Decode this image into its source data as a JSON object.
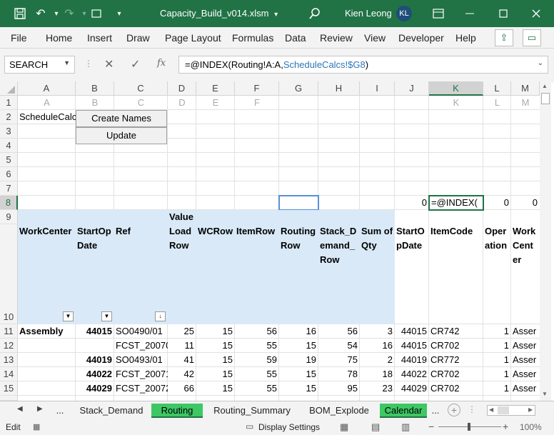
{
  "title_bar": {
    "filename": "Capacity_Build_v014.xlsm",
    "dropdown_glyph": "▾",
    "user_name": "Kien Leong",
    "user_initials": "KL",
    "bg_color": "#217346"
  },
  "menu": {
    "items": [
      "File",
      "Home",
      "Insert",
      "Draw",
      "Page Layout",
      "Formulas",
      "Data",
      "Review",
      "View",
      "Developer",
      "Help"
    ]
  },
  "formula_bar": {
    "name_box": "SEARCH",
    "formula_prefix": "=@INDEX(Routing!A:A,",
    "formula_ref": "ScheduleCalcs!$G8",
    "formula_suffix": ")",
    "fx": "fx"
  },
  "columns": [
    "A",
    "B",
    "C",
    "D",
    "E",
    "F",
    "G",
    "H",
    "I",
    "J",
    "K",
    "L",
    "M"
  ],
  "ghost_row": [
    "A",
    "B",
    "C",
    "D",
    "E",
    "F",
    "",
    "",
    "",
    "",
    "K",
    "L",
    "M"
  ],
  "rows": [
    "1",
    "2",
    "3",
    "4",
    "5",
    "6",
    "7",
    "8",
    "9",
    "10",
    "11",
    "12",
    "13",
    "14",
    "15"
  ],
  "a2_text": "ScheduleCalc",
  "buttons": {
    "create_names": "Create Names",
    "update": "Update"
  },
  "row8": {
    "j": "0",
    "k": "=@INDEX(",
    "l": "0",
    "m": "0"
  },
  "headers": {
    "a": "WorkCenter",
    "b1": "StartOp",
    "b2": "Date",
    "c": "Ref",
    "d1": "Value",
    "d2": "Load",
    "d3": "Row",
    "e": "WCRow",
    "f": "ItemRow",
    "g1": "Routing",
    "g2": "Row",
    "h1": "Stack_D",
    "h2": "emand_",
    "h3": "Row",
    "i1": "Sum of",
    "i2": "Qty",
    "j1": "StartO",
    "j2": "pDate",
    "k": "ItemCode",
    "l1": "Oper",
    "l2": "ation",
    "m1": "Work",
    "m2": "Cent",
    "m3": "er"
  },
  "table_rows": [
    {
      "a": "Assembly",
      "b": "44015",
      "c": "SO0490/01",
      "d": "25",
      "e": "15",
      "f": "56",
      "g": "16",
      "h": "56",
      "i": "3",
      "j": "44015",
      "k": "CR742",
      "l": "1",
      "m": "Asser"
    },
    {
      "a": "",
      "b": "",
      "c": "FCST_20070",
      "d": "11",
      "e": "15",
      "f": "55",
      "g": "15",
      "h": "54",
      "i": "16",
      "j": "44015",
      "k": "CR702",
      "l": "1",
      "m": "Asser"
    },
    {
      "a": "",
      "b": "44019",
      "c": "SO0493/01",
      "d": "41",
      "e": "15",
      "f": "59",
      "g": "19",
      "h": "75",
      "i": "2",
      "j": "44019",
      "k": "CR772",
      "l": "1",
      "m": "Asser"
    },
    {
      "a": "",
      "b": "44022",
      "c": "FCST_20071",
      "d": "42",
      "e": "15",
      "f": "55",
      "g": "15",
      "h": "78",
      "i": "18",
      "j": "44022",
      "k": "CR702",
      "l": "1",
      "m": "Asser"
    },
    {
      "a": "",
      "b": "44029",
      "c": "FCST_20072",
      "d": "66",
      "e": "15",
      "f": "55",
      "g": "15",
      "h": "95",
      "i": "23",
      "j": "44029",
      "k": "CR702",
      "l": "1",
      "m": "Asser"
    }
  ],
  "sheet_tabs": [
    {
      "label": "...",
      "active": false
    },
    {
      "label": "Stack_Demand",
      "active": false
    },
    {
      "label": "Routing",
      "active": true
    },
    {
      "label": "Routing_Summary",
      "active": false
    },
    {
      "label": "BOM_Explode",
      "active": false
    },
    {
      "label": "Calendar",
      "active": true
    },
    {
      "label": "...",
      "active": false
    }
  ],
  "status_bar": {
    "mode": "Edit",
    "display_settings": "Display Settings",
    "zoom": "100%"
  },
  "colors": {
    "header_fill": "#d9e9f7",
    "active_tab": "#3ec765"
  }
}
